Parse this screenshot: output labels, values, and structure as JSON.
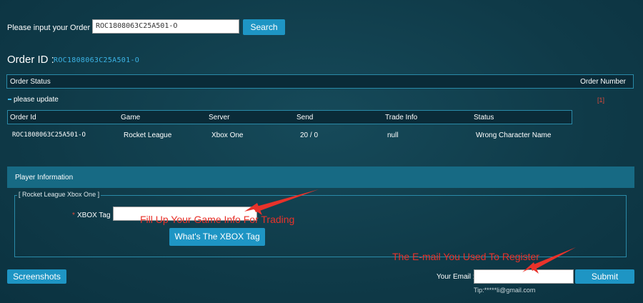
{
  "search": {
    "label": "Please input your Order No:",
    "value": "ROC1808063C25A501-O",
    "button": "Search"
  },
  "order": {
    "title": "Order ID :",
    "id": "ROC1808063C25A501-O"
  },
  "status_table": {
    "col_status": "Order Status",
    "col_number": "Order Number",
    "status_text": "please update",
    "order_number": "[1]"
  },
  "detail_table": {
    "headers": [
      "Order Id",
      "Game",
      "Server",
      "Send",
      "Trade Info",
      "Status"
    ],
    "row": [
      "ROC1808063C25A501-O",
      "Rocket League",
      "Xbox One",
      "20 / 0",
      "null",
      "Wrong Character Name"
    ]
  },
  "player": {
    "header": "Player Information",
    "legend": "[ Rocket League Xbox One ]",
    "required_mark": "*",
    "xbox_label": "XBOX Tag",
    "xbox_value": "",
    "xbox_help_button": "What's The XBOX Tag"
  },
  "annotations": {
    "game_info": "Fill Up Your Game Info For Trading",
    "email": "The E-mail You Used To Register"
  },
  "footer": {
    "screenshots_button": "Screenshots",
    "email_label": "Your Email :",
    "email_value": "",
    "submit_button": "Submit",
    "tip": "Tip:*****li@gmail.com"
  },
  "colors": {
    "background": "#0f3a48",
    "accent": "#1e95c4",
    "link": "#3cb4e6",
    "annotation": "#e8322a"
  }
}
